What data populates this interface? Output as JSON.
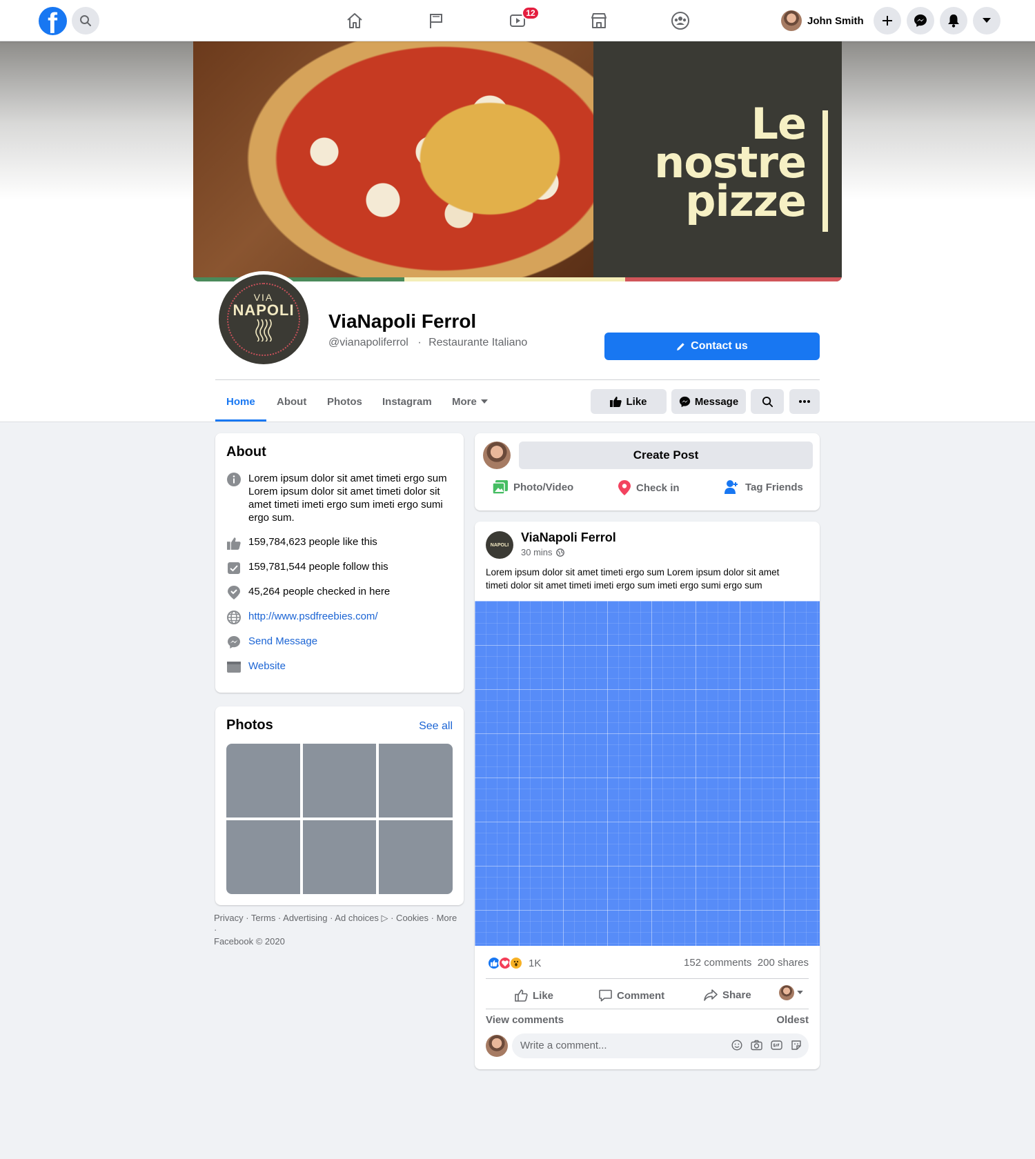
{
  "topnav": {
    "logo": "f",
    "notification_count": "12",
    "user_name": "John Smith",
    "icons": [
      "search-icon",
      "home-icon",
      "pages-flag-icon",
      "watch-icon",
      "marketplace-icon",
      "groups-icon",
      "plus-icon",
      "messenger-icon",
      "bell-icon",
      "caret-down-icon"
    ]
  },
  "cover": {
    "line1": "Le",
    "line2": "nostre",
    "line3": "pizze",
    "flag_colors": [
      "#4a8a5a",
      "#f4eeb8",
      "#d05559"
    ]
  },
  "profile": {
    "logo_top": "VIA",
    "logo_main": "NAPOLI",
    "name": "ViaNapoli Ferrol",
    "handle": "@vianapoliferrol",
    "category": "Restaurante Italiano",
    "separator": "·",
    "contact_label": "Contact us"
  },
  "tabs": {
    "home": "Home",
    "about": "About",
    "photos": "Photos",
    "instagram": "Instagram",
    "more": "More",
    "like_label": "Like",
    "message_label": "Message"
  },
  "about": {
    "title": "About",
    "description": "Lorem ipsum dolor sit amet timeti ergo sum Lorem ipsum dolor sit amet timeti dolor sit amet timeti imeti ergo sum imeti ergo sumi ergo sum.",
    "likes": "159,784,623 people like this",
    "follows": "159,781,544 people follow this",
    "checkins": "45,264 people checked in here",
    "url": "http://www.psdfreebies.com/",
    "send_message": "Send Message",
    "website": "Website"
  },
  "photos": {
    "title": "Photos",
    "see_all": "See all"
  },
  "footer": {
    "links": "Privacy · Terms · Advertising · Ad choices ▷ · Cookies · More ·",
    "copyright": "Facebook © 2020"
  },
  "create_post": {
    "button": "Create Post",
    "photo_video": "Photo/Video",
    "check_in": "Check in",
    "tag_friends": "Tag Friends"
  },
  "post": {
    "author": "ViaNapoli Ferrol",
    "time": "30 mins",
    "text": "Lorem ipsum dolor sit amet timeti ergo sum Lorem ipsum dolor sit amet timeti dolor sit amet timeti imeti ergo sum imeti ergo sumi ergo sum",
    "reactions_count": "1K",
    "comments": "152 comments",
    "shares": "200 shares",
    "like": "Like",
    "comment": "Comment",
    "share": "Share",
    "view_comments": "View comments",
    "sort": "Oldest",
    "comment_placeholder": "Write a comment..."
  },
  "colors": {
    "brand_blue": "#1877f2",
    "link_blue": "#1b64d4",
    "placeholder_blue": "#578cf8",
    "photo_tile_gray": "#8a929c"
  }
}
